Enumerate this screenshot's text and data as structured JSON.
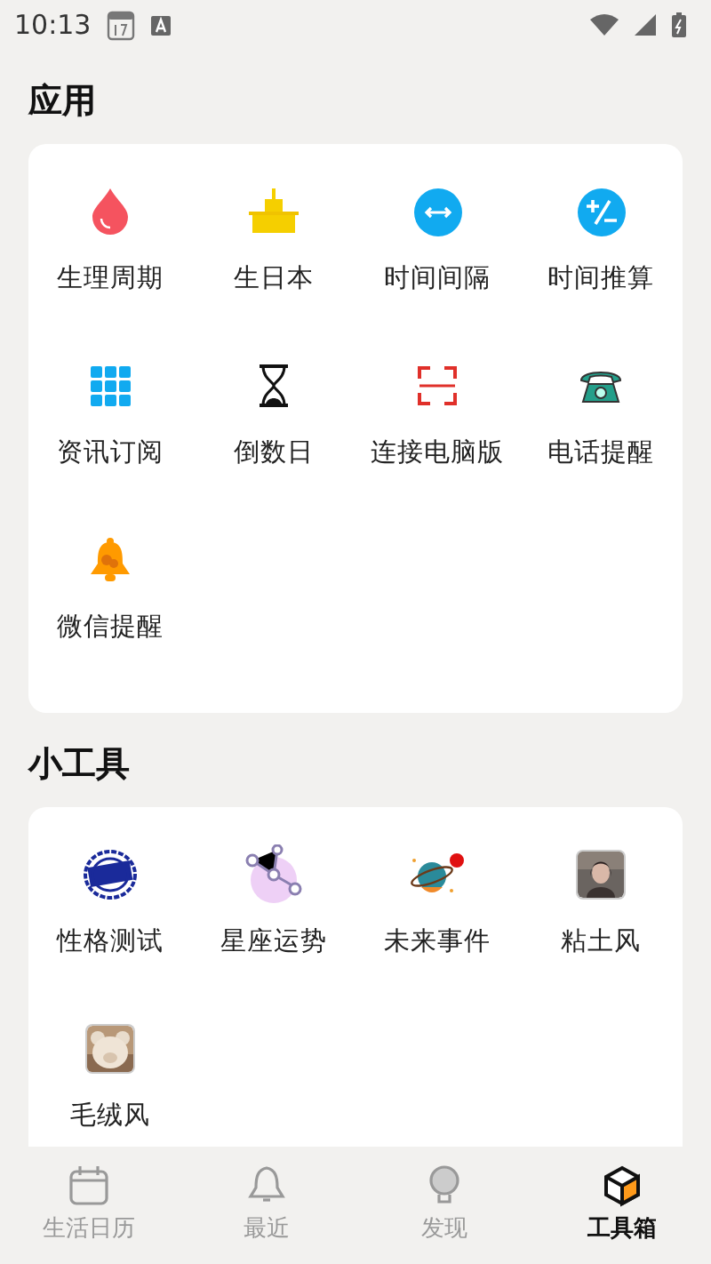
{
  "status_bar": {
    "time": "10:13"
  },
  "sections": [
    {
      "title": "应用",
      "items": [
        {
          "label": "生理周期"
        },
        {
          "label": "生日本"
        },
        {
          "label": "时间间隔"
        },
        {
          "label": "时间推算"
        },
        {
          "label": "资讯订阅"
        },
        {
          "label": "倒数日"
        },
        {
          "label": "连接电脑版"
        },
        {
          "label": "电话提醒"
        },
        {
          "label": "微信提醒"
        }
      ]
    },
    {
      "title": "小工具",
      "items": [
        {
          "label": "性格测试"
        },
        {
          "label": "星座运势"
        },
        {
          "label": "未来事件"
        },
        {
          "label": "粘土风",
          "kind": "picture"
        },
        {
          "label": "毛绒风",
          "kind": "picture"
        }
      ]
    }
  ],
  "bottom_nav": [
    {
      "label": "生活日历",
      "selected": false
    },
    {
      "label": "最近",
      "selected": false
    },
    {
      "label": "发现",
      "selected": false
    },
    {
      "label": "工具箱",
      "selected": true
    }
  ]
}
